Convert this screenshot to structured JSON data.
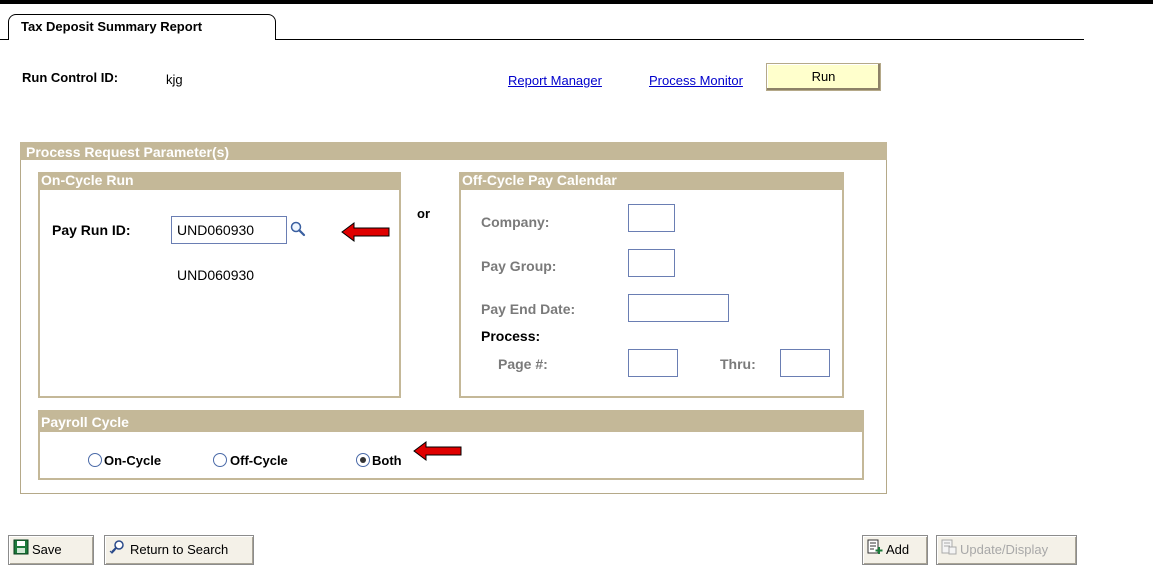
{
  "tab": {
    "label": "Tax Deposit Summary Report"
  },
  "run_control": {
    "label": "Run Control ID:",
    "value": "kjg"
  },
  "links": {
    "report_manager": "Report Manager",
    "process_monitor": "Process Monitor"
  },
  "run_button": "Run",
  "process_request": {
    "title": "Process Request Parameter(s)",
    "on_cycle": {
      "title": "On-Cycle Run",
      "pay_run_id_label": "Pay Run ID:",
      "pay_run_id_value": "UND060930",
      "pay_run_id_description": "UND060930"
    },
    "or_label": "or",
    "off_cycle": {
      "title": "Off-Cycle Pay Calendar",
      "company_label": "Company:",
      "company_value": "",
      "pay_group_label": "Pay Group:",
      "pay_group_value": "",
      "pay_end_date_label": "Pay End Date:",
      "pay_end_date_value": "",
      "process_label": "Process:",
      "page_label": "Page #:",
      "page_value": "",
      "thru_label": "Thru:",
      "thru_value": ""
    },
    "payroll_cycle": {
      "title": "Payroll Cycle",
      "options": [
        "On-Cycle",
        "Off-Cycle",
        "Both"
      ],
      "selected": "Both"
    }
  },
  "bottom_buttons": {
    "save": "Save",
    "return_to_search": "Return to Search",
    "add": "Add",
    "update_display": "Update/Display"
  },
  "colors": {
    "group_header": "#c4b898",
    "link": "#0000cc",
    "run_button_bg": "#ffffcc",
    "annotation_arrow": "#e00000"
  },
  "icons": {
    "lookup": "magnifier-icon",
    "save": "floppy-disk-icon",
    "return": "return-search-icon",
    "add": "add-icon",
    "update": "update-display-icon",
    "annotation": "red-arrow-icon"
  }
}
